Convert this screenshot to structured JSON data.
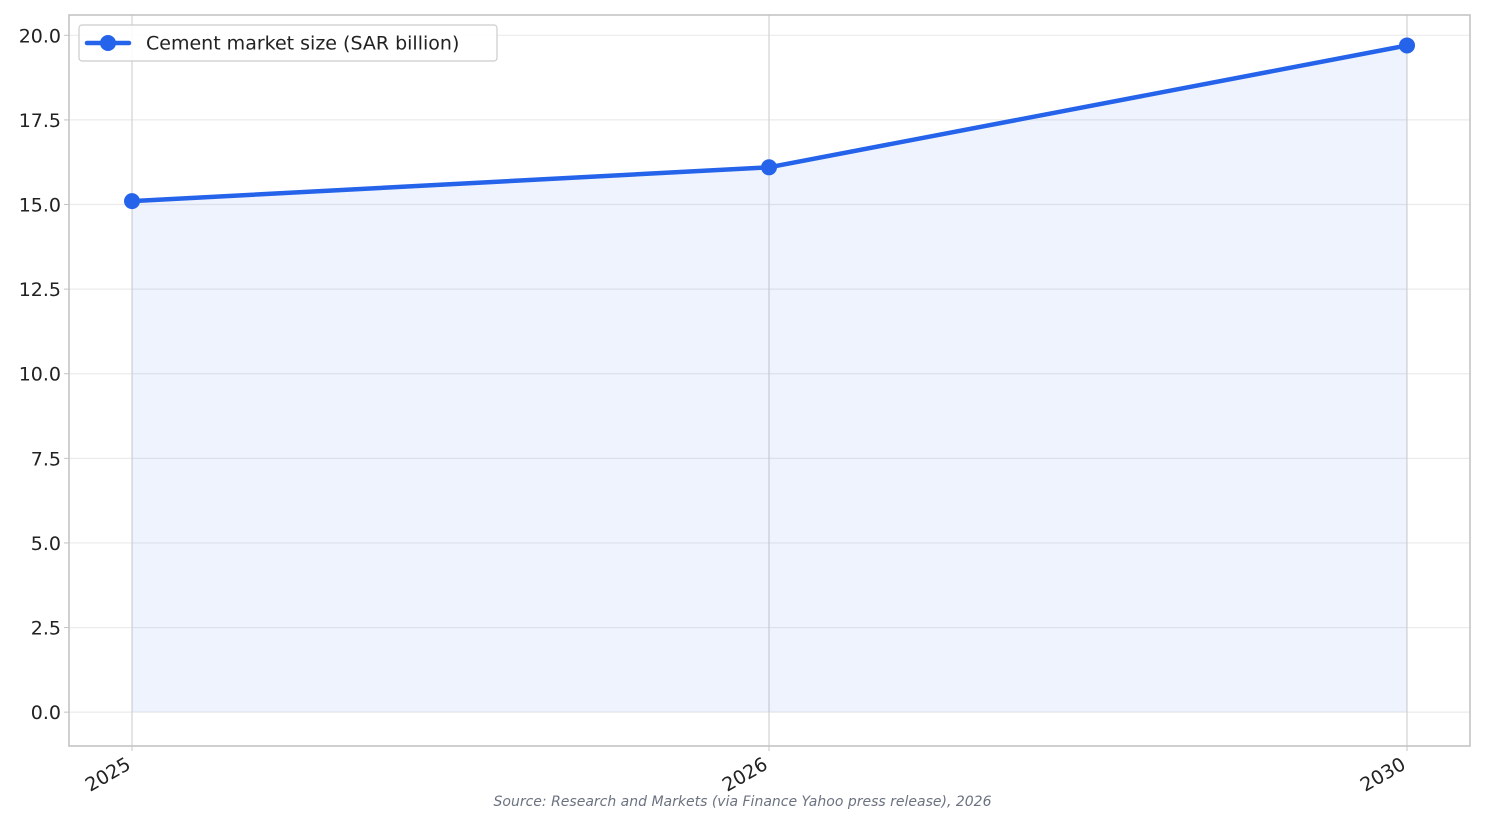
{
  "chart_data": {
    "type": "area",
    "categories": [
      "2025",
      "2026",
      "2030"
    ],
    "series": [
      {
        "name": "Cement market size (SAR billion)",
        "values": [
          15.1,
          16.1,
          19.7
        ],
        "color": "#2563eb",
        "fill_color": "#eef2fb",
        "marker": "circle"
      }
    ],
    "ylim": [
      -1,
      20.6
    ],
    "yticks": [
      0.0,
      2.5,
      5.0,
      7.5,
      10.0,
      12.5,
      15.0,
      17.5,
      20.0
    ],
    "ytick_labels": [
      "0.0",
      "2.5",
      "5.0",
      "7.5",
      "10.0",
      "12.5",
      "15.0",
      "17.5",
      "20.0"
    ],
    "xticks": [
      "2025",
      "2026",
      "2030"
    ],
    "title": "",
    "xlabel": "",
    "ylabel": "",
    "grid": true,
    "legend_position": "top-left",
    "source": "Source: Research and Markets (via Finance Yahoo press release), 2026"
  }
}
